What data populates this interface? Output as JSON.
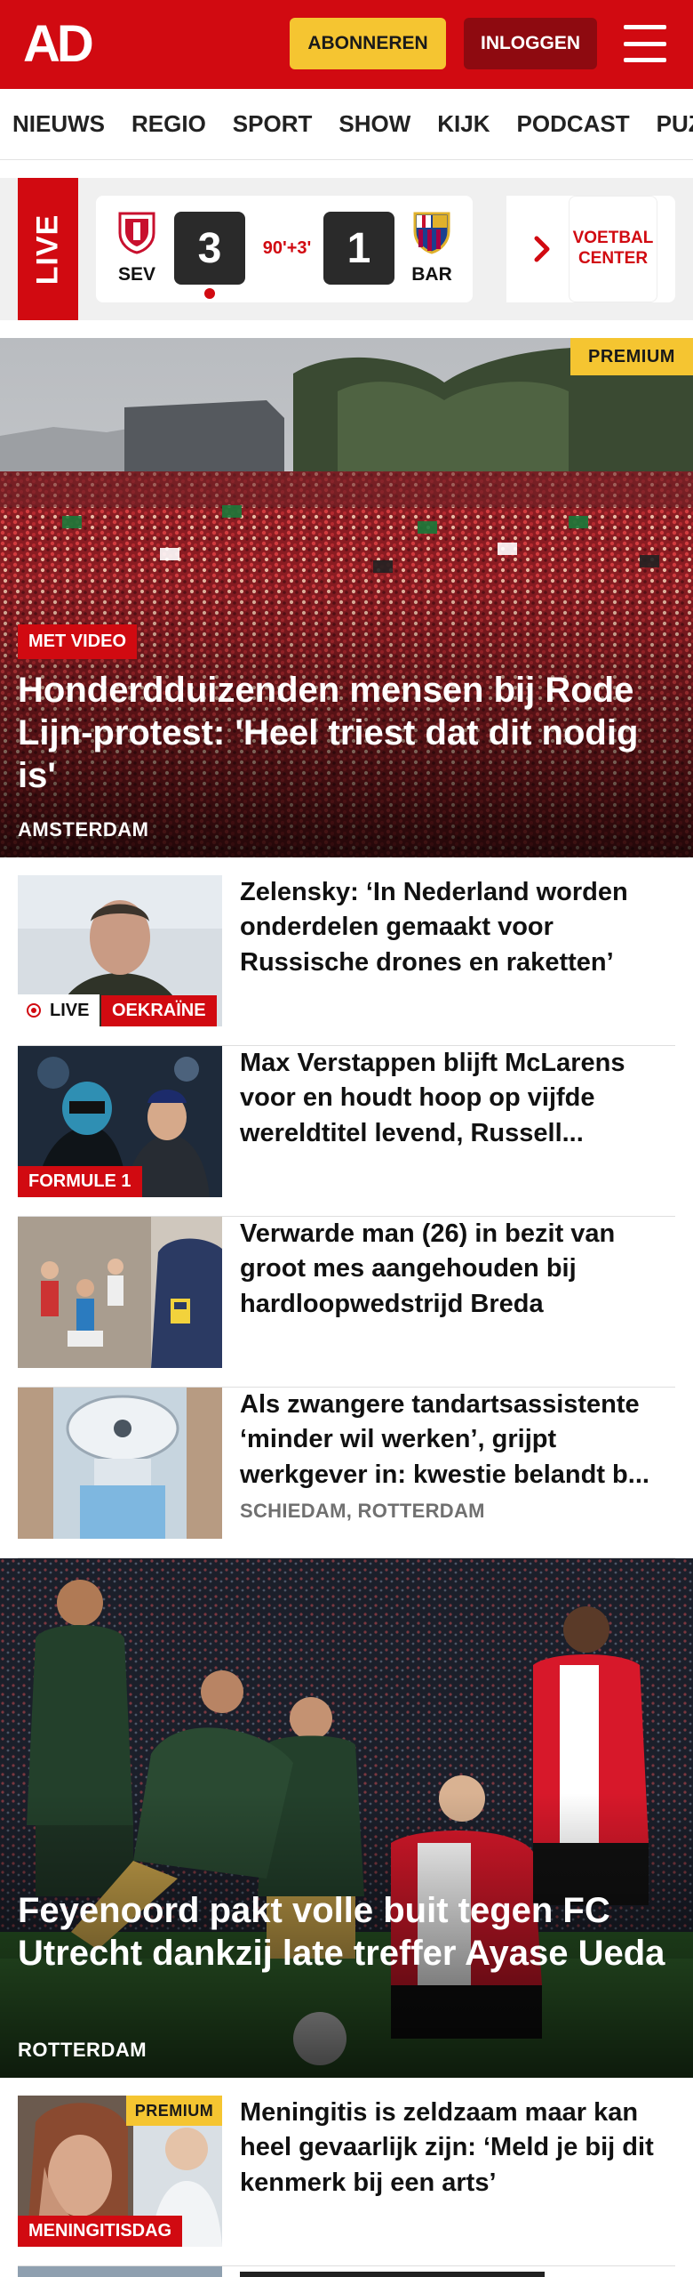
{
  "header": {
    "logo": "AD",
    "subscribe_label": "ABONNEREN",
    "login_label": "INLOGGEN"
  },
  "nav": {
    "items": [
      "NIEUWS",
      "REGIO",
      "SPORT",
      "SHOW",
      "KIJK",
      "PODCAST",
      "PUZZ"
    ]
  },
  "live": {
    "label": "LIVE",
    "match": {
      "home_team": "SEV",
      "away_team": "BAR",
      "home_score": "3",
      "away_score": "1",
      "time": "90'+3'"
    },
    "voetbal_center_label": "VOETBAL CENTER"
  },
  "hero": {
    "premium_label": "PREMIUM",
    "video_label": "MET VIDEO",
    "title": "Honderdduizenden mensen bij Rode Lijn-protest: 'Heel triest dat dit nodig is'",
    "location": "AMSTERDAM"
  },
  "articles": [
    {
      "title": "Zelensky: ‘In Nederland worden onderdelen gemaakt voor Russische drones en raketten’",
      "live_label": "LIVE",
      "category": "OEKRAÏNE"
    },
    {
      "title": "Max Verstappen blijft McLarens voor en houdt hoop op vijfde wereldtitel levend, Russell...",
      "category": "FORMULE 1"
    },
    {
      "title": "Verwarde man (26) in bezit van groot mes aangehouden bij hardloopwedstrijd Breda"
    },
    {
      "title": "Als zwangere tandartsassistente ‘minder wil werken’, grijpt werkgever in: kwestie belandt b...",
      "location": "SCHIEDAM, ROTTERDAM"
    }
  ],
  "hero2": {
    "title": "Feyenoord pakt volle buit tegen FC Utrecht dankzij late treffer Ayase Ueda",
    "location": "ROTTERDAM"
  },
  "article5": {
    "premium_label": "PREMIUM",
    "title": "Meningitis is zeldzaam maar kan heel gevaarlijk zijn: ‘Meld je bij dit kenmerk bij een arts’",
    "category": "MENINGITISDAG"
  },
  "colors": {
    "brand_red": "#d10a11",
    "dark_red": "#8e0a10",
    "premium_yellow": "#f5c531"
  }
}
